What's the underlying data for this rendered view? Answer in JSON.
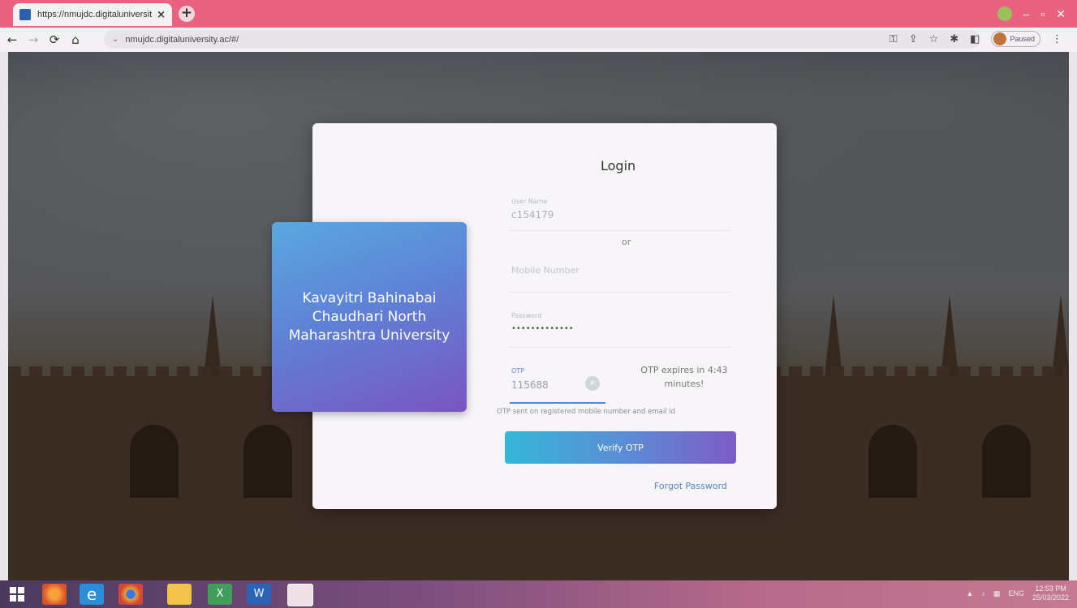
{
  "browser": {
    "tab_title": "https://nmujdc.digitaluniversity.ac/#/",
    "tab_close": "×",
    "new_tab": "+",
    "url": "nmujdc.digitaluniversity.ac/#/",
    "profile_status": "Paused",
    "win_min": "–",
    "win_max": "▫",
    "win_close": "✕"
  },
  "brand": {
    "university_name": "Kavayitri Bahinabai Chaudhari North Maharashtra University"
  },
  "login": {
    "title": "Login",
    "user_label": "User Name",
    "user_value": "c154179",
    "or_text": "or",
    "mobile_placeholder": "Mobile Number",
    "password_label": "Password",
    "password_value": "•••••••••••••",
    "otp_label": "OTP",
    "otp_value": "115688",
    "otp_expiry": "OTP expires in 4:43 minutes!",
    "otp_hint": "OTP sent on registered mobile number and email id",
    "verify_button": "Verify OTP",
    "forgot_password": "Forgot Password"
  },
  "taskbar": {
    "apps": [
      "firefox-icon",
      "internet-explorer-icon",
      "chrome-icon",
      "file-explorer-icon",
      "excel-icon",
      "word-icon",
      "paint-icon"
    ],
    "language": "ENG",
    "time": "12:53 PM",
    "date": "25/03/2022"
  },
  "colors": {
    "tab_bar": "#e9627f",
    "card_gradient_start": "#5aa8e0",
    "card_gradient_end": "#7a55c2",
    "link": "#4f86c9"
  }
}
